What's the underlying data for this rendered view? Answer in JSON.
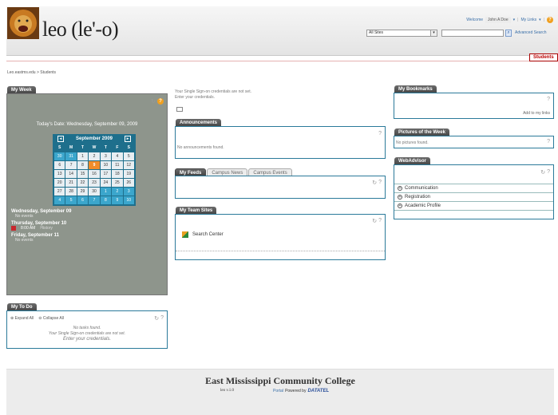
{
  "header": {
    "site_title": "leo (le'-o)",
    "welcome_label": "Welcome",
    "user_name": "John A Doe",
    "my_links": "My Links",
    "sites_select_value": "All Sites",
    "advanced_search": "Advanced Search"
  },
  "nav": {
    "active_tab": "Students",
    "breadcrumb": "Leo.eastms.edu > Students"
  },
  "my_week": {
    "title": "My Week",
    "today_text": "Today's Date:  Wednesday, September 09, 2009",
    "calendar": {
      "month": "September 2009",
      "dow": [
        "S",
        "M",
        "T",
        "W",
        "T",
        "F",
        "S"
      ],
      "weeks": [
        [
          "30",
          "31",
          "1",
          "2",
          "3",
          "4",
          "5"
        ],
        [
          "6",
          "7",
          "8",
          "9",
          "10",
          "11",
          "12"
        ],
        [
          "13",
          "14",
          "15",
          "16",
          "17",
          "18",
          "19"
        ],
        [
          "20",
          "21",
          "22",
          "23",
          "24",
          "25",
          "26"
        ],
        [
          "27",
          "28",
          "29",
          "30",
          "1",
          "2",
          "3"
        ],
        [
          "4",
          "5",
          "6",
          "7",
          "8",
          "9",
          "10"
        ]
      ],
      "today": "9"
    },
    "days": [
      {
        "label": "Wednesday, September 09",
        "none": "No events"
      },
      {
        "label": "Thursday, September 10",
        "event_time": "8:00 AM",
        "event_name": "History"
      },
      {
        "label": "Friday, September 11",
        "none": "No events"
      }
    ]
  },
  "my_todo": {
    "title": "My To Do",
    "expand": "Expand All",
    "collapse": "Collapse All",
    "no_tasks": "No tasks found.",
    "sso_msg": "Your Single Sign-on credentials are not set.",
    "enter_creds": "Enter your credentials."
  },
  "center": {
    "sso_msg": "Your Single Sign-on credentials are not set.",
    "enter_creds": "Enter your credentials.",
    "announcements_title": "Announcements",
    "no_announcements": "No announcements found.",
    "feed_tabs": [
      "My Feeds",
      "Campus News",
      "Campus Events"
    ],
    "team_sites_title": "My Team Sites",
    "search_center": "Search Center"
  },
  "right": {
    "bookmarks_title": "My Bookmarks",
    "add_to_links": "Add to my links",
    "pictures_title": "Pictures of the Week",
    "no_pictures": "No pictures found.",
    "webadvisor_title": "WebAdvisor",
    "webadvisor_items": [
      "Communication",
      "Registration",
      "Academic Profile"
    ]
  },
  "footer": {
    "college": "East Mississippi Community College",
    "version": "leo v.1.0",
    "portal": "Portal",
    "powered_by": "Powered by",
    "vendor": "DATATEL"
  },
  "colors": {
    "accent": "#1e6f8c",
    "today": "#f08c2a",
    "students_tab": "#b00000"
  }
}
